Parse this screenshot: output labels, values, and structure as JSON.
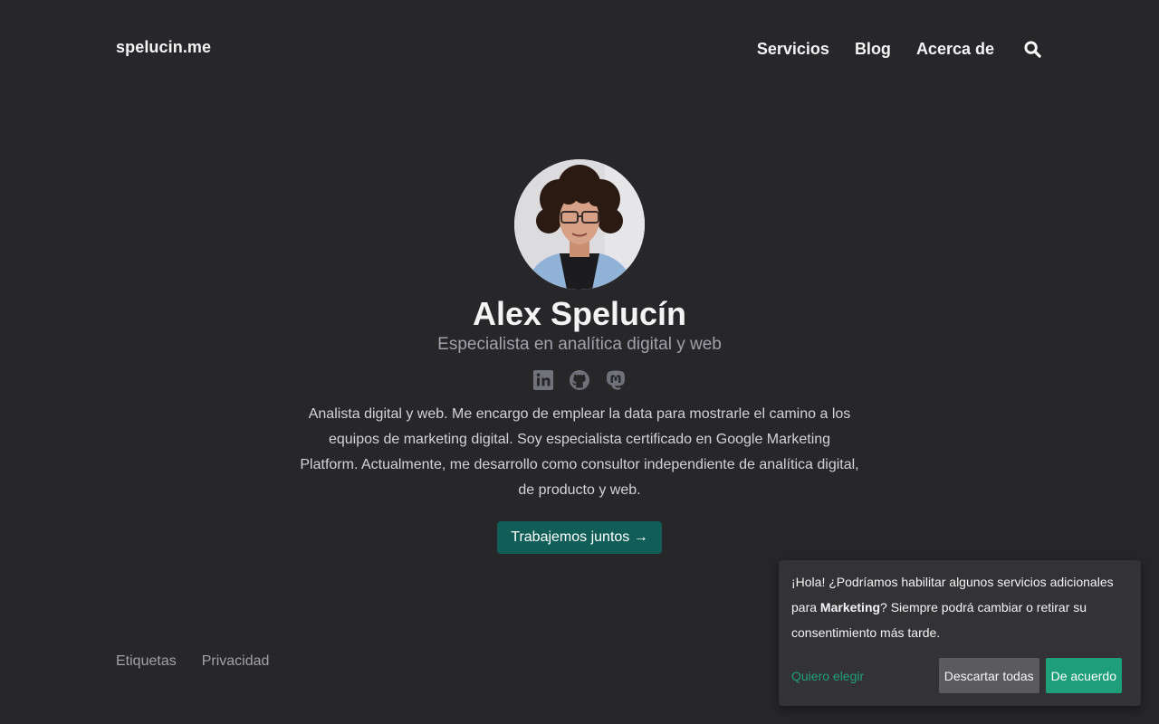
{
  "header": {
    "site_title": "spelucin.me",
    "nav": [
      {
        "label": "Servicios"
      },
      {
        "label": "Blog"
      },
      {
        "label": "Acerca de"
      }
    ],
    "search_icon": "search-icon"
  },
  "profile": {
    "name": "Alex Spelucín",
    "headline": "Especialista en analítica digital y web",
    "social_icons": [
      "linkedin-icon",
      "github-icon",
      "mastodon-icon"
    ],
    "bio": "Analista digital y web. Me encargo de emplear la data para mostrarle el camino a los equipos de marketing digital. Soy especialista certificado en Google Marketing Platform. Actualmente, me desarrollo como consultor independiente de analítica digital, de producto y web.",
    "cta_label": "Trabajemos juntos →"
  },
  "footer": {
    "links": [
      {
        "label": "Etiquetas"
      },
      {
        "label": "Privacidad"
      }
    ]
  },
  "consent": {
    "text_before": "¡Hola! ¿Podríamos habilitar algunos servicios adicionales para ",
    "purpose": "Marketing",
    "text_after": "? Siempre podrá cambiar o retirar su consentimiento más tarde.",
    "learn_more": "Quiero elegir",
    "decline": "Descartar todas",
    "accept": "De acuerdo"
  },
  "colors": {
    "background": "#27272a",
    "cta": "#115e59",
    "consent_accent": "#1f9e7a",
    "consent_bg": "#333335"
  }
}
